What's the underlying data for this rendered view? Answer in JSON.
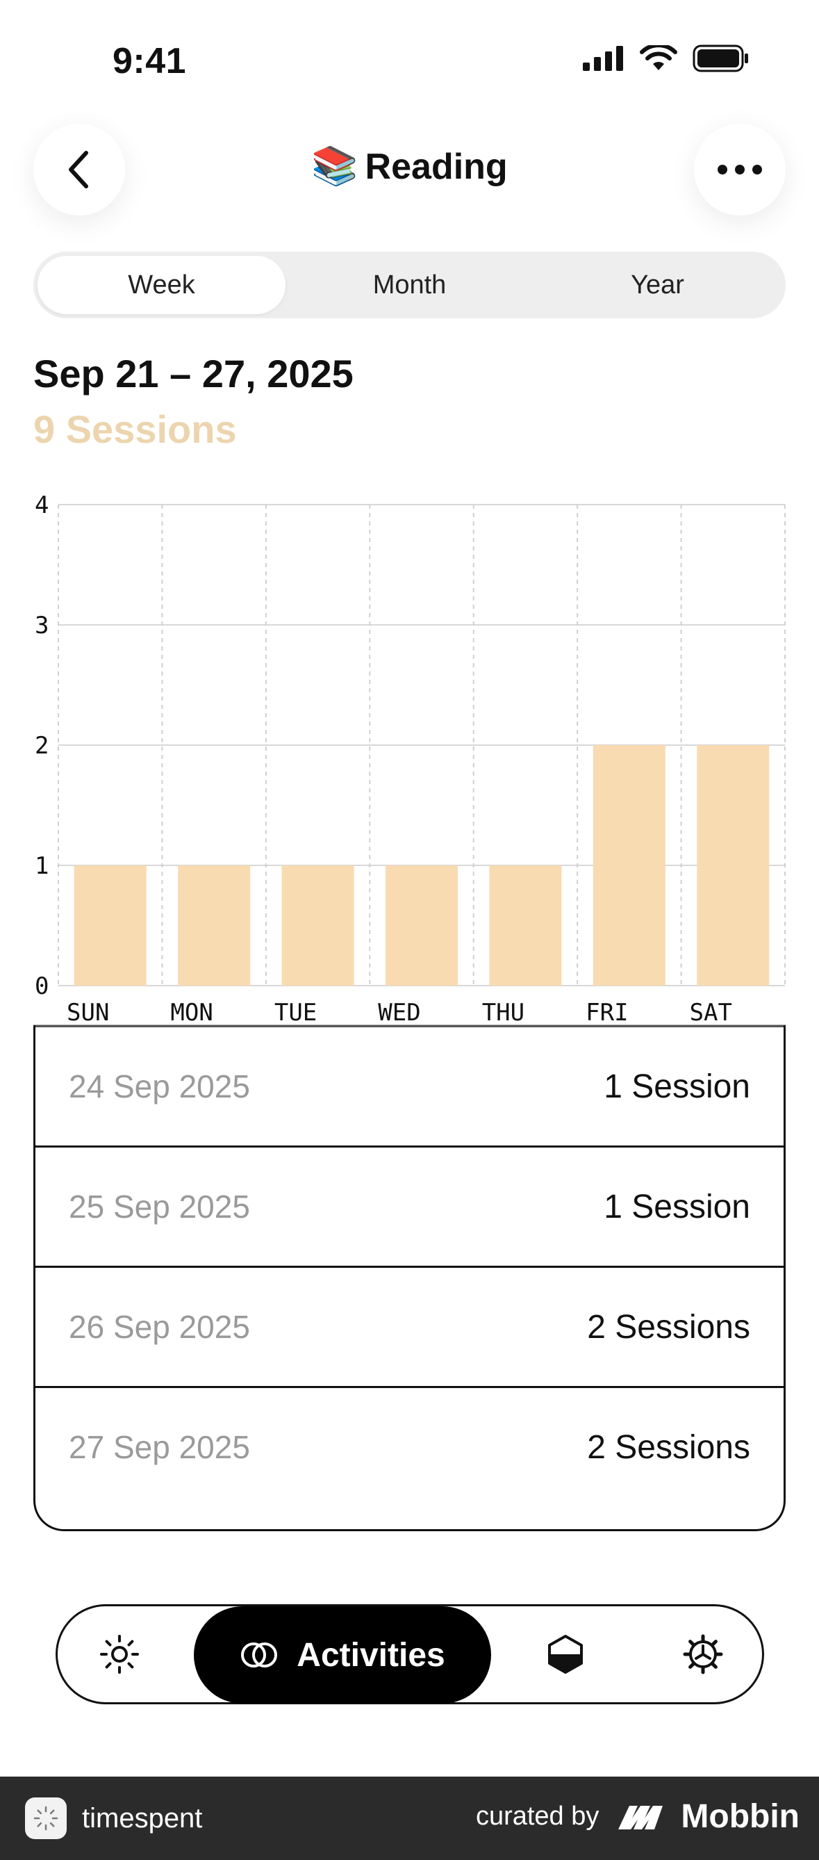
{
  "status_bar": {
    "time": "9:41"
  },
  "header": {
    "title": "Reading",
    "emoji": "📚"
  },
  "segments": [
    {
      "label": "Week",
      "active": true
    },
    {
      "label": "Month",
      "active": false
    },
    {
      "label": "Year",
      "active": false
    }
  ],
  "range": {
    "title": "Sep 21 – 27, 2025",
    "subtitle": "9 Sessions"
  },
  "colors": {
    "bar": "#f9dbb2",
    "subtitle": "#ecd5ae",
    "accent": "#000000"
  },
  "chart_data": {
    "type": "bar",
    "categories": [
      "SUN",
      "MON",
      "TUE",
      "WED",
      "THU",
      "FRI",
      "SAT"
    ],
    "values": [
      1,
      1,
      1,
      1,
      1,
      2,
      2
    ],
    "yticks": [
      0,
      1,
      2,
      3,
      4
    ],
    "ylim": [
      0,
      4
    ],
    "grid": true
  },
  "list": [
    {
      "date": "24 Sep 2025",
      "count": "1 Session"
    },
    {
      "date": "25 Sep 2025",
      "count": "1 Session"
    },
    {
      "date": "26 Sep 2025",
      "count": "2 Sessions"
    },
    {
      "date": "27 Sep 2025",
      "count": "2 Sessions"
    }
  ],
  "tabbar": {
    "active_label": "Activities",
    "icons": [
      "sun-icon",
      "activities-icon",
      "hexagon-icon",
      "gear-icon"
    ]
  },
  "footer": {
    "app_name": "timespent",
    "curated_by": "curated by",
    "brand": "Mobbin"
  }
}
